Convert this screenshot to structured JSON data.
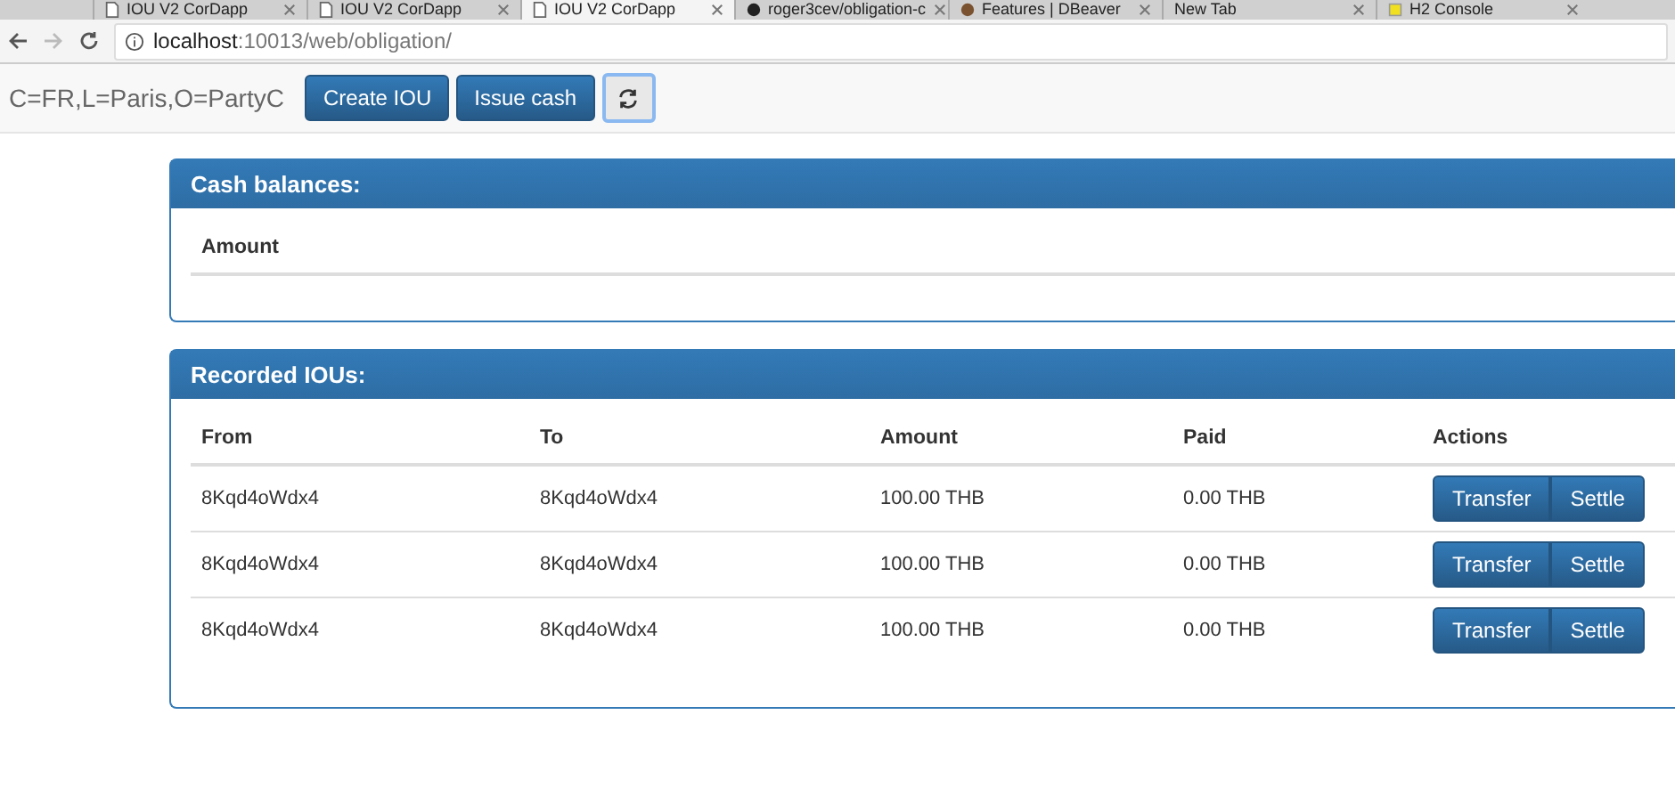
{
  "browser": {
    "tabs": [
      {
        "title": "IOU V2 CorDapp",
        "selected": false,
        "kind": "page"
      },
      {
        "title": "IOU V2 CorDapp",
        "selected": false,
        "kind": "page"
      },
      {
        "title": "IOU V2 CorDapp",
        "selected": true,
        "kind": "page"
      },
      {
        "title": "roger3cev/obligation-c",
        "selected": false,
        "kind": "repo"
      },
      {
        "title": "Features | DBeaver",
        "selected": false,
        "kind": "app"
      },
      {
        "title": "New Tab",
        "selected": false,
        "kind": "blank"
      },
      {
        "title": "H2 Console",
        "selected": false,
        "kind": "console"
      }
    ],
    "address": {
      "host": "localhost",
      "path": ":10013/web/obligation/"
    }
  },
  "header": {
    "party": "C=FR,L=Paris,O=PartyC",
    "buttons": [
      "Create IOU",
      "Issue cash"
    ]
  },
  "cash_panel": {
    "title": "Cash balances:",
    "columns": [
      "Amount"
    ]
  },
  "iou_panel": {
    "title": "Recorded IOUs:",
    "columns": [
      "From",
      "To",
      "Amount",
      "Paid",
      "Actions"
    ],
    "rows": [
      {
        "from": "8Kqd4oWdx4",
        "to": "8Kqd4oWdx4",
        "amount": "100.00 THB",
        "paid": "0.00 THB",
        "actions": [
          "Transfer",
          "Settle"
        ]
      },
      {
        "from": "8Kqd4oWdx4",
        "to": "8Kqd4oWdx4",
        "amount": "100.00 THB",
        "paid": "0.00 THB",
        "actions": [
          "Transfer",
          "Settle"
        ]
      },
      {
        "from": "8Kqd4oWdx4",
        "to": "8Kqd4oWdx4",
        "amount": "100.00 THB",
        "paid": "0.00 THB",
        "actions": [
          "Transfer",
          "Settle"
        ]
      }
    ]
  }
}
